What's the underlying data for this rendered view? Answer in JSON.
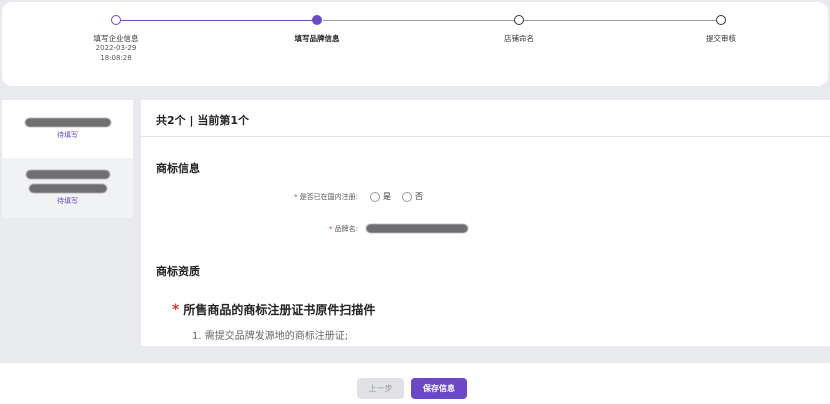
{
  "stepper": {
    "steps": [
      {
        "label": "填写企业信息",
        "date": "2022-03-29",
        "time": "18:08:28"
      },
      {
        "label": "填写品牌信息"
      },
      {
        "label": "店铺命名"
      },
      {
        "label": "提交审核"
      }
    ]
  },
  "sidebar": {
    "items": [
      {
        "status": "待填写"
      },
      {
        "status": "待填写"
      }
    ]
  },
  "main": {
    "header": "共2个 | 当前第1个",
    "trademark_section": "商标信息",
    "registered_label": "是否已在国内注册:",
    "option_yes": "是",
    "option_no": "否",
    "brand_name_label": "品牌名:",
    "qualification_section": "商标资质",
    "scan_title": "所售商品的商标注册证书原件扫描件",
    "notes": [
      "1. 需提交品牌发源地的商标注册证;"
    ]
  },
  "footer": {
    "prev_label": "上一步",
    "save_label": "保存信息"
  },
  "colors": {
    "accent": "#6b48c8",
    "required": "#d4343a"
  }
}
